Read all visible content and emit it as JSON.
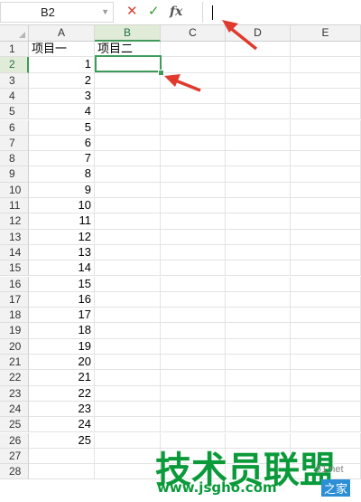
{
  "formula_bar": {
    "name_box": "B2",
    "cancel_glyph": "✕",
    "confirm_glyph": "✓",
    "fx_label": "fx",
    "formula_value": ""
  },
  "columns": [
    "A",
    "B",
    "C",
    "D",
    "E"
  ],
  "rows": [
    "1",
    "2",
    "3",
    "4",
    "5",
    "6",
    "7",
    "8",
    "9",
    "10",
    "11",
    "12",
    "13",
    "14",
    "15",
    "16",
    "17",
    "18",
    "19",
    "20",
    "21",
    "22",
    "23",
    "24",
    "25",
    "26",
    "27",
    "28"
  ],
  "cells": {
    "A1": "项目一",
    "B1": "项目二",
    "A_values": [
      "1",
      "2",
      "3",
      "4",
      "5",
      "6",
      "7",
      "8",
      "9",
      "10",
      "11",
      "12",
      "13",
      "14",
      "15",
      "16",
      "17",
      "18",
      "19",
      "20",
      "21",
      "22",
      "23",
      "24",
      "25"
    ]
  },
  "selected_cell": "B2",
  "colors": {
    "accent": "#3e9b5a",
    "arrow": "#e03a2f",
    "cancel": "#d9443a",
    "confirm": "#3a9a3a"
  },
  "watermark": {
    "title": "技术员联盟",
    "url": "www.jsgho.com",
    "suffix": "51.net",
    "tag": "之家"
  }
}
